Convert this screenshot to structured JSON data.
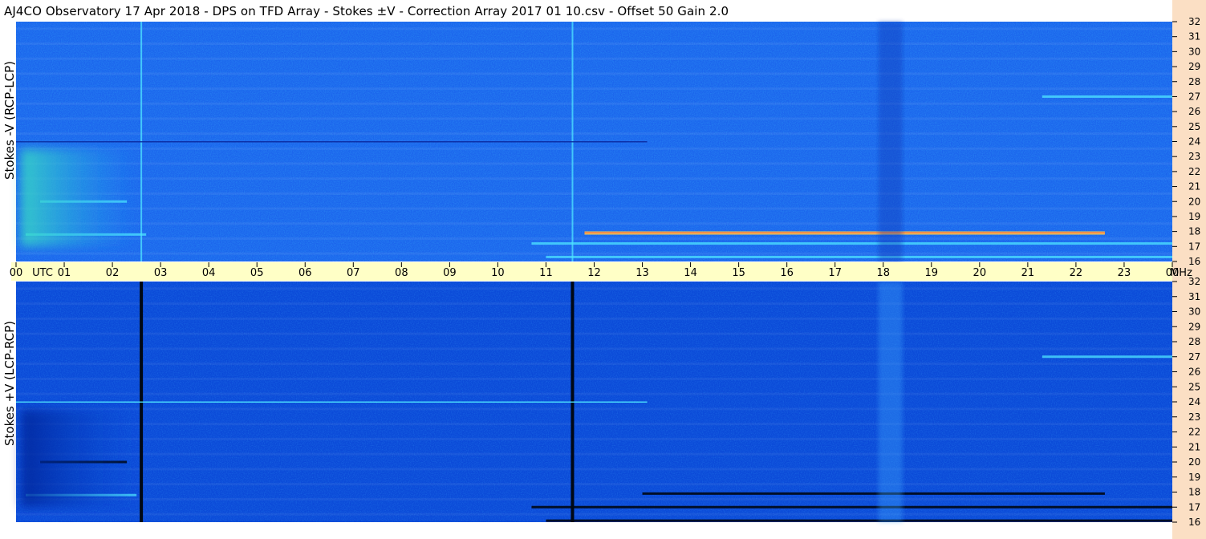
{
  "title": "AJ4CO Observatory  17 Apr 2018  -  DPS on TFD Array  -  Stokes ±V  -  Correction Array 2017 01 10.csv  -  Offset 50  Gain 2.0",
  "colors": {
    "top_panel_base": "#1b64ec",
    "bottom_panel_base": "#0b4ad8",
    "time_axis_bg": "#ffffc6",
    "freq_strip_bg": "#fbdfc4"
  },
  "chart_data": [
    {
      "type": "heatmap",
      "title": "",
      "ylabel": "Stokes -V (RCP-LCP)",
      "xlabel": "",
      "x_ticks": [
        "00",
        "UTC",
        "01",
        "02",
        "03",
        "04",
        "05",
        "06",
        "07",
        "08",
        "09",
        "10",
        "11",
        "12",
        "13",
        "14",
        "15",
        "16",
        "17",
        "18",
        "19",
        "20",
        "21",
        "22",
        "23",
        "00",
        "MHz"
      ],
      "xlim_hours_utc": [
        0,
        24
      ],
      "ylim_mhz": [
        16,
        32
      ],
      "y_ticks": [
        "32",
        "31",
        "30",
        "29",
        "28",
        "27",
        "26",
        "25",
        "24",
        "23",
        "22",
        "21",
        "20",
        "19",
        "18",
        "17",
        "16"
      ],
      "features": [
        {
          "kind": "vertical_line",
          "at_hour": 2.6,
          "tone": "bright"
        },
        {
          "kind": "vertical_line",
          "at_hour": 11.55,
          "tone": "bright"
        },
        {
          "kind": "horizontal_line",
          "at_mhz": 24.0,
          "from_hour": 0.0,
          "to_hour": 13.1,
          "tone": "dark"
        },
        {
          "kind": "horizontal_band",
          "at_mhz": 17.9,
          "from_hour": 11.8,
          "to_hour": 22.6,
          "tone": "hot"
        },
        {
          "kind": "horizontal_band",
          "at_mhz": 17.2,
          "from_hour": 10.7,
          "to_hour": 24.0,
          "tone": "bright"
        },
        {
          "kind": "horizontal_band",
          "at_mhz": 16.3,
          "from_hour": 11.0,
          "to_hour": 24.0,
          "tone": "bright"
        },
        {
          "kind": "horizontal_band",
          "at_mhz": 20.0,
          "from_hour": 0.5,
          "to_hour": 2.3,
          "tone": "bright"
        },
        {
          "kind": "horizontal_band",
          "at_mhz": 17.8,
          "from_hour": 0.2,
          "to_hour": 2.7,
          "tone": "bright"
        },
        {
          "kind": "horizontal_band",
          "at_mhz": 27.0,
          "from_hour": 21.3,
          "to_hour": 24.0,
          "tone": "bright"
        },
        {
          "kind": "diffuse_patch",
          "from_hour": 0.1,
          "to_hour": 2.5,
          "from_mhz": 17.0,
          "to_mhz": 23.5,
          "tone": "bright"
        },
        {
          "kind": "vertical_band",
          "from_hour": 17.9,
          "to_hour": 18.4,
          "tone": "dark"
        }
      ]
    },
    {
      "type": "heatmap",
      "title": "",
      "ylabel": "Stokes +V (LCP-RCP)",
      "xlabel": "",
      "xlim_hours_utc": [
        0,
        24
      ],
      "ylim_mhz": [
        16,
        32
      ],
      "y_ticks": [
        "32",
        "31",
        "30",
        "29",
        "28",
        "27",
        "26",
        "25",
        "24",
        "23",
        "22",
        "21",
        "20",
        "19",
        "18",
        "17",
        "16"
      ],
      "features": [
        {
          "kind": "vertical_line",
          "at_hour": 2.6,
          "tone": "black"
        },
        {
          "kind": "vertical_line",
          "at_hour": 11.55,
          "tone": "black"
        },
        {
          "kind": "horizontal_line",
          "at_mhz": 24.0,
          "from_hour": 0.0,
          "to_hour": 13.1,
          "tone": "bright"
        },
        {
          "kind": "horizontal_band",
          "at_mhz": 17.9,
          "from_hour": 13.0,
          "to_hour": 22.6,
          "tone": "black"
        },
        {
          "kind": "horizontal_band",
          "at_mhz": 17.0,
          "from_hour": 10.7,
          "to_hour": 24.0,
          "tone": "black"
        },
        {
          "kind": "horizontal_band",
          "at_mhz": 16.1,
          "from_hour": 11.0,
          "to_hour": 24.0,
          "tone": "black"
        },
        {
          "kind": "horizontal_band",
          "at_mhz": 17.8,
          "from_hour": 0.2,
          "to_hour": 2.5,
          "tone": "bright"
        },
        {
          "kind": "horizontal_band",
          "at_mhz": 20.0,
          "from_hour": 0.5,
          "to_hour": 2.3,
          "tone": "black"
        },
        {
          "kind": "horizontal_band",
          "at_mhz": 27.0,
          "from_hour": 21.3,
          "to_hour": 24.0,
          "tone": "bright"
        },
        {
          "kind": "diffuse_patch",
          "from_hour": 0.1,
          "to_hour": 2.5,
          "from_mhz": 17.0,
          "to_mhz": 23.5,
          "tone": "dark"
        },
        {
          "kind": "vertical_band",
          "from_hour": 17.9,
          "to_hour": 18.4,
          "tone": "bright"
        }
      ]
    }
  ]
}
